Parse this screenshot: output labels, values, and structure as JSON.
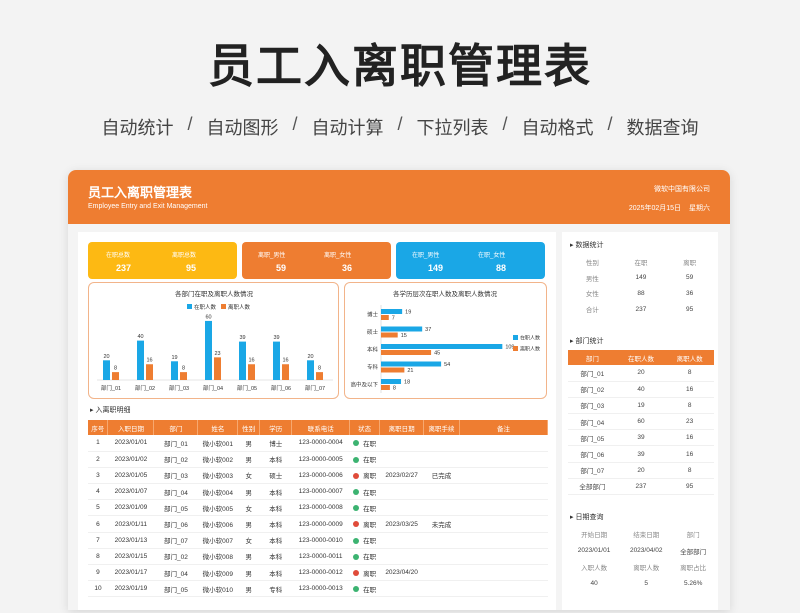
{
  "hero": {
    "title": "员工入离职管理表",
    "features": [
      "自动统计",
      "自动图形",
      "自动计算",
      "下拉列表",
      "自动格式",
      "数据查询"
    ],
    "separator": "/"
  },
  "header": {
    "title": "员工入离职管理表",
    "subtitle": "Employee Entry and Exit Management",
    "company": "微软中国有限公司",
    "date": "2025年02月15日",
    "weekday": "星期六"
  },
  "kpis": {
    "total": {
      "label_a": "在职总数",
      "value_a": "237",
      "label_b": "离职总数",
      "value_b": "95",
      "color": "#fdb913"
    },
    "male_female_left": {
      "label_a": "离职_男性",
      "value_a": "59",
      "label_b": "离职_女性",
      "value_b": "36",
      "color": "#ee7d31"
    },
    "male_female_in": {
      "label_a": "在职_男性",
      "value_a": "149",
      "label_b": "在职_女性",
      "value_b": "88",
      "color": "#1aa7e6"
    }
  },
  "chart_data": [
    {
      "type": "bar",
      "title": "各部门在职及离职人数情况",
      "categories": [
        "部门_01",
        "部门_02",
        "部门_03",
        "部门_04",
        "部门_05",
        "部门_06",
        "部门_07"
      ],
      "series": [
        {
          "name": "在职人数",
          "values": [
            20,
            40,
            19,
            60,
            39,
            39,
            20
          ],
          "color": "#1aa7e6"
        },
        {
          "name": "离职人数",
          "values": [
            8,
            16,
            8,
            23,
            16,
            16,
            8
          ],
          "color": "#ee7d31"
        }
      ],
      "ylim": [
        0,
        65
      ],
      "legend": "top-center"
    },
    {
      "type": "bar",
      "orientation": "horizontal",
      "title": "各学历层次在职人数及离职人数情况",
      "categories": [
        "博士",
        "硕士",
        "本科",
        "专科",
        "高中及以下"
      ],
      "series": [
        {
          "name": "在职人数",
          "values": [
            19,
            37,
            109,
            54,
            18
          ],
          "color": "#1aa7e6"
        },
        {
          "name": "离职人数",
          "values": [
            7,
            15,
            45,
            21,
            8
          ],
          "color": "#ee7d31"
        }
      ],
      "xlim": [
        0,
        115
      ],
      "legend": "right"
    }
  ],
  "table": {
    "section_title": "入离职明细",
    "columns": [
      "序号",
      "入职日期",
      "部门",
      "姓名",
      "性别",
      "学历",
      "联系电话",
      "状态",
      "离职日期",
      "离职手续",
      "备注"
    ],
    "rows": [
      [
        "1",
        "2023/01/01",
        "部门_01",
        "微小软001",
        "男",
        "博士",
        "123-0000-0004",
        "在职",
        "",
        "",
        ""
      ],
      [
        "2",
        "2023/01/02",
        "部门_02",
        "微小软002",
        "男",
        "本科",
        "123-0000-0005",
        "在职",
        "",
        "",
        ""
      ],
      [
        "3",
        "2023/01/05",
        "部门_03",
        "微小软003",
        "女",
        "硕士",
        "123-0000-0006",
        "离职",
        "2023/02/27",
        "已完成",
        ""
      ],
      [
        "4",
        "2023/01/07",
        "部门_04",
        "微小软004",
        "男",
        "本科",
        "123-0000-0007",
        "在职",
        "",
        "",
        ""
      ],
      [
        "5",
        "2023/01/09",
        "部门_05",
        "微小软005",
        "女",
        "本科",
        "123-0000-0008",
        "在职",
        "",
        "",
        ""
      ],
      [
        "6",
        "2023/01/11",
        "部门_06",
        "微小软006",
        "男",
        "本科",
        "123-0000-0009",
        "离职",
        "2023/03/25",
        "未完成",
        ""
      ],
      [
        "7",
        "2023/01/13",
        "部门_07",
        "微小软007",
        "女",
        "本科",
        "123-0000-0010",
        "在职",
        "",
        "",
        ""
      ],
      [
        "8",
        "2023/01/15",
        "部门_02",
        "微小软008",
        "男",
        "本科",
        "123-0000-0011",
        "在职",
        "",
        "",
        ""
      ],
      [
        "9",
        "2023/01/17",
        "部门_04",
        "微小软009",
        "男",
        "本科",
        "123-0000-0012",
        "离职",
        "2023/04/20",
        "",
        ""
      ],
      [
        "10",
        "2023/01/19",
        "部门_05",
        "微小软010",
        "男",
        "专科",
        "123-0000-0013",
        "在职",
        "",
        "",
        ""
      ]
    ]
  },
  "stats": {
    "section_title": "数据统计",
    "headers": [
      "性别",
      "在职",
      "离职"
    ],
    "rows": [
      [
        "男性",
        "149",
        "59"
      ],
      [
        "女性",
        "88",
        "36"
      ],
      [
        "合计",
        "237",
        "95"
      ]
    ]
  },
  "dept_stats": {
    "section_title": "部门统计",
    "headers": [
      "部门",
      "在职人数",
      "离职人数"
    ],
    "rows": [
      [
        "部门_01",
        "20",
        "8"
      ],
      [
        "部门_02",
        "40",
        "16"
      ],
      [
        "部门_03",
        "19",
        "8"
      ],
      [
        "部门_04",
        "60",
        "23"
      ],
      [
        "部门_05",
        "39",
        "16"
      ],
      [
        "部门_06",
        "39",
        "16"
      ],
      [
        "部门_07",
        "20",
        "8"
      ],
      [
        "全部部门",
        "237",
        "95"
      ]
    ]
  },
  "date_query": {
    "section_title": "日期查询",
    "headers1": [
      "开始日期",
      "结束日期",
      "部门"
    ],
    "values1": [
      "2023/01/01",
      "2023/04/02",
      "全部部门"
    ],
    "headers2": [
      "入职人数",
      "离职人数",
      "离职占比"
    ],
    "values2": [
      "40",
      "5",
      "5.26%"
    ]
  },
  "colors": {
    "accent": "#ee7d31",
    "blue": "#1aa7e6",
    "yellow": "#fdb913",
    "status_in": "#3cb371",
    "status_out": "#e04b3a"
  }
}
